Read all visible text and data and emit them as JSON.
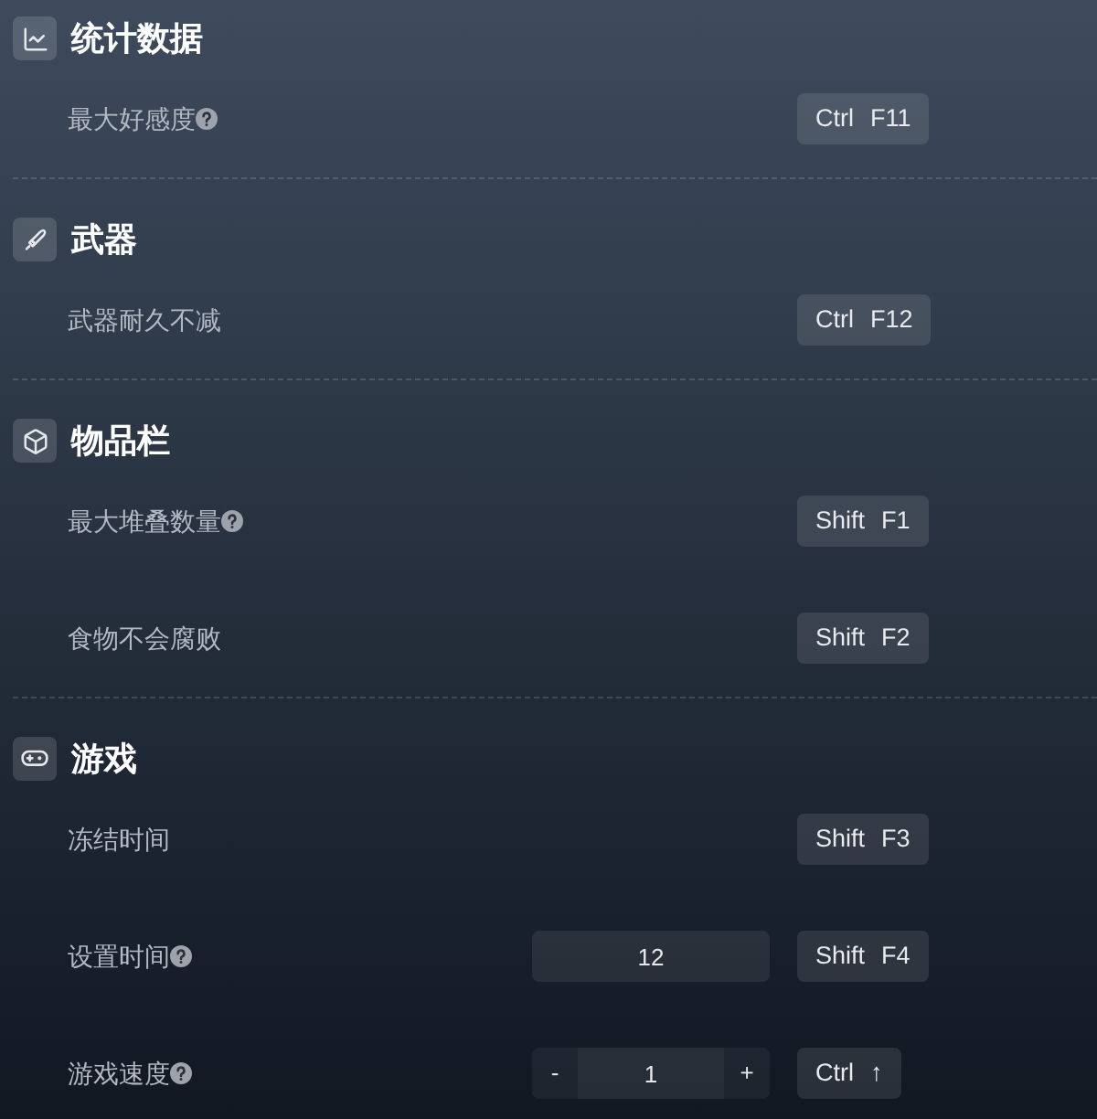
{
  "sections": [
    {
      "title": "统计数据",
      "items": [
        {
          "label": "最大好感度",
          "help": true,
          "kind": "toggle",
          "hotkey": [
            "Ctrl",
            "F11"
          ]
        }
      ]
    },
    {
      "title": "武器",
      "items": [
        {
          "label": "武器耐久不减",
          "help": false,
          "kind": "toggle",
          "hotkey": [
            "Ctrl",
            "F12"
          ]
        }
      ]
    },
    {
      "title": "物品栏",
      "items": [
        {
          "label": "最大堆叠数量",
          "help": true,
          "kind": "toggle",
          "hotkey": [
            "Shift",
            "F1"
          ]
        },
        {
          "label": "食物不会腐败",
          "help": false,
          "kind": "toggle",
          "hotkey": [
            "Shift",
            "F2"
          ]
        }
      ]
    },
    {
      "title": "游戏",
      "items": [
        {
          "label": "冻结时间",
          "help": false,
          "kind": "toggle",
          "hotkey": [
            "Shift",
            "F3"
          ]
        },
        {
          "label": "设置时间",
          "help": true,
          "kind": "number",
          "value": "12",
          "hotkey": [
            "Shift",
            "F4"
          ]
        },
        {
          "label": "游戏速度",
          "help": true,
          "kind": "stepper",
          "value": "1",
          "decrement": "-",
          "increment": "+",
          "hotkey": [
            "Ctrl",
            "↑"
          ]
        }
      ]
    }
  ]
}
